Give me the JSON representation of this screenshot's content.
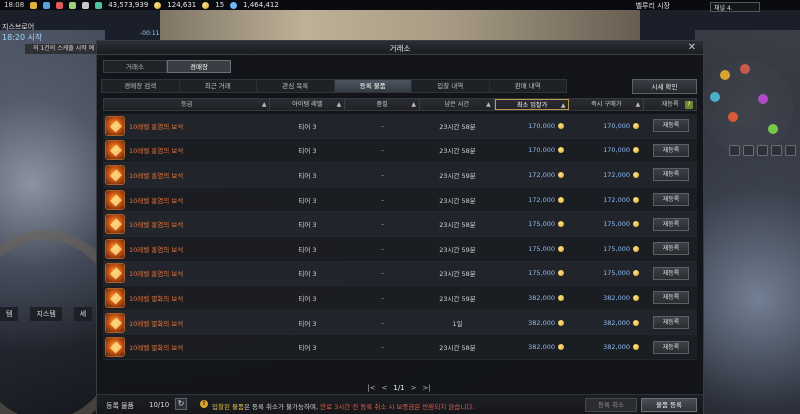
{
  "hud": {
    "clock": "18:08",
    "currency1": "43,573,939",
    "currency2": "124,631",
    "currency3": "15",
    "currency4": "1,464,412",
    "zone": "벨루리 시장",
    "channel": "채널 4."
  },
  "quest": {
    "area": "지스브로어",
    "time": "18:20 시작",
    "objective": "의 1건의 스케줄 시작 예",
    "timer": "-00:11"
  },
  "side_labels": [
    "템",
    "지스템",
    "세"
  ],
  "window": {
    "title": "거래소",
    "close": "✕"
  },
  "main_tabs": [
    {
      "label": "거래소",
      "active": false
    },
    {
      "label": "경매장",
      "active": true
    }
  ],
  "sub_tabs": [
    {
      "label": "경매장 검색",
      "active": false
    },
    {
      "label": "최근 거래",
      "active": false
    },
    {
      "label": "관심 목록",
      "active": false
    },
    {
      "label": "등록 물품",
      "active": true
    },
    {
      "label": "입찰 내역",
      "active": false
    },
    {
      "label": "판매 내역",
      "active": false
    }
  ],
  "price_check_label": "시세 확인",
  "columns": {
    "grade": "등급",
    "item_level": "아이템 레벨",
    "quality": "품질",
    "time_left": "남은 시간",
    "min_bid": "최소 입찰가",
    "buyout": "즉시 구매가",
    "relist": "재등록",
    "help": "?"
  },
  "rows": [
    {
      "name": "10레벨 홍염의 보석",
      "level": "티어 3",
      "quality": "-",
      "time": "23시간 58분",
      "min": "170,000",
      "buy": "170,000",
      "btn": "재등록"
    },
    {
      "name": "10레벨 홍염의 보석",
      "level": "티어 3",
      "quality": "-",
      "time": "23시간 58분",
      "min": "170,000",
      "buy": "170,000",
      "btn": "재등록"
    },
    {
      "name": "10레벨 홍염의 보석",
      "level": "티어 3",
      "quality": "-",
      "time": "23시간 59분",
      "min": "172,000",
      "buy": "172,000",
      "btn": "재등록"
    },
    {
      "name": "10레벨 홍염의 보석",
      "level": "티어 3",
      "quality": "-",
      "time": "23시간 58분",
      "min": "172,000",
      "buy": "172,000",
      "btn": "재등록"
    },
    {
      "name": "10레벨 홍염의 보석",
      "level": "티어 3",
      "quality": "-",
      "time": "23시간 58분",
      "min": "175,000",
      "buy": "175,000",
      "btn": "재등록"
    },
    {
      "name": "10레벨 홍염의 보석",
      "level": "티어 3",
      "quality": "-",
      "time": "23시간 59분",
      "min": "175,000",
      "buy": "175,000",
      "btn": "재등록"
    },
    {
      "name": "10레벨 홍염의 보석",
      "level": "티어 3",
      "quality": "-",
      "time": "23시간 58분",
      "min": "175,000",
      "buy": "175,000",
      "btn": "재등록"
    },
    {
      "name": "10레벨 멸화의 보석",
      "level": "티어 3",
      "quality": "-",
      "time": "23시간 59분",
      "min": "382,000",
      "buy": "382,000",
      "btn": "재등록"
    },
    {
      "name": "10레벨 멸화의 보석",
      "level": "티어 3",
      "quality": "-",
      "time": "1일",
      "min": "382,000",
      "buy": "382,000",
      "btn": "재등록"
    },
    {
      "name": "10레벨 멸화의 보석",
      "level": "티어 3",
      "quality": "-",
      "time": "23시간 58분",
      "min": "382,000",
      "buy": "382,000",
      "btn": "재등록"
    }
  ],
  "pager": {
    "first": "|<",
    "prev": "<",
    "page": "1/1",
    "next": ">",
    "last": ">|"
  },
  "footer": {
    "label": "등록 물품",
    "count": "10/10",
    "notice_a": "입찰된 물품",
    "notice_b": "은 등록 취소가 불가능하며, ",
    "notice_c": "만료 3시간 전 등록 취소 시 보증금은 반환되지 않습니다.",
    "cancel_label": "등록 취소",
    "register_label": "물품 등록"
  },
  "colors": {
    "item_name": "#e8743a",
    "price": "#8fbaf0",
    "accent_gold": "#b79b4a"
  }
}
